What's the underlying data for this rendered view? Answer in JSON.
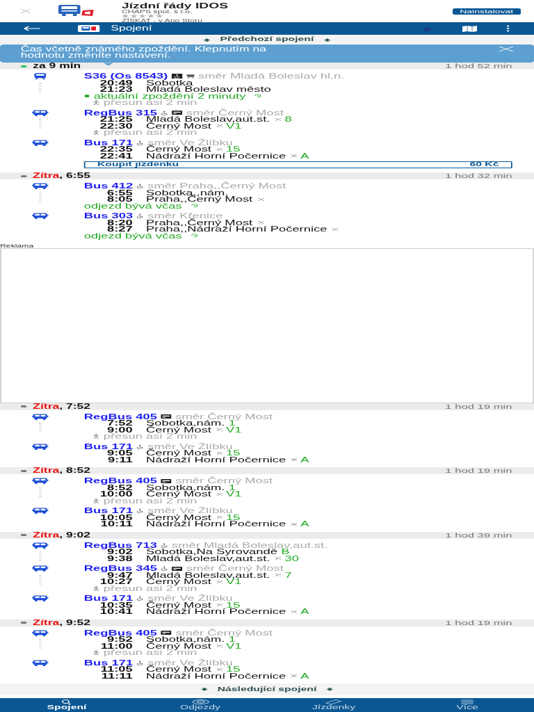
{
  "app_banner": {
    "title": "Jízdní řády IDOS",
    "publisher": "CHAPS spol. s r.o.",
    "stars": 0,
    "store_text": "ZÍSKAT - v App Storu",
    "install_button": "Nainstalovat"
  },
  "nav": {
    "title": "Spojení"
  },
  "previous": "Předchozí spojení",
  "info": "Čas včetně známého zpoždění. Klepnutím na hodnotu změníte nastavení.",
  "connections": [
    {
      "color": "#22c55e",
      "label": "za 9 min",
      "duration": "1 hod 52 min",
      "legs": [
        {
          "kind": "train",
          "line": "S36 (Os 8543)",
          "icons": [
            {
              "kind": "accessible_box"
            },
            {
              "kind": "cart"
            }
          ],
          "direction": "směr Mladá Boleslav hl.n.",
          "stops": [
            {
              "time": "20:49",
              "name": "Sobotka",
              "request": false
            },
            {
              "time": "21:23",
              "name": "Mladá Boleslav město",
              "request": false
            }
          ],
          "notes": [
            {
              "kind": "delay",
              "text": "aktuální zpoždění 2 minuty"
            },
            {
              "kind": "transfer",
              "text": "přesun asi 2 min"
            }
          ]
        },
        {
          "kind": "bus",
          "line": "RegBus 315",
          "icons": [
            {
              "kind": "accessible"
            },
            {
              "kind": "card"
            }
          ],
          "direction": "směr Černý Most",
          "stops": [
            {
              "time": "21:25",
              "name": "Mladá Boleslav,aut.st.",
              "request": true,
              "platform": "8"
            },
            {
              "time": "22:30",
              "name": "Černý Most",
              "request": true,
              "platform": "V1"
            }
          ],
          "notes": [
            {
              "kind": "transfer",
              "text": "přesun asi 2 min"
            }
          ]
        },
        {
          "kind": "bus",
          "line": "Bus 171",
          "icons": [
            {
              "kind": "accessible"
            }
          ],
          "direction": "směr Ve Žlíbku",
          "stops": [
            {
              "time": "22:35",
              "name": "Černý Most",
              "request": true,
              "platform": "15"
            },
            {
              "time": "22:41",
              "name": "Nádraží Horní Počernice",
              "request": true,
              "platform": "A"
            }
          ]
        }
      ],
      "ticket": {
        "label": "Koupit jízdenku",
        "price": "60 Kč"
      }
    },
    {
      "color": "#777777",
      "day": "Zítra",
      "label": ", 6:55",
      "duration": "1 hod 32 min",
      "legs": [
        {
          "kind": "bus",
          "line": "Bus 412",
          "icons": [
            {
              "kind": "accessible"
            }
          ],
          "direction": "směr Praha,,Černý Most",
          "stops": [
            {
              "time": "6:55",
              "name": "Sobotka,,nám.",
              "request": false
            },
            {
              "time": "8:05",
              "name": "Praha,,Černý Most",
              "request": true
            }
          ],
          "notes": [
            {
              "kind": "punctual",
              "text": "odjezd bývá včas"
            }
          ]
        },
        {
          "kind": "bus",
          "line": "Bus 303",
          "icons": [
            {
              "kind": "accessible"
            }
          ],
          "direction": "směr Křenice",
          "stops": [
            {
              "time": "8:20",
              "name": "Praha,,Černý Most",
              "request": true
            },
            {
              "time": "8:27",
              "name": "Praha,,Nádraží Horní Počernice",
              "request": true
            }
          ],
          "notes": [
            {
              "kind": "punctual",
              "text": "odjezd bývá včas"
            }
          ]
        }
      ]
    },
    {
      "kind": "ad",
      "label": "Reklama"
    },
    {
      "color": "#777777",
      "day": "Zítra",
      "label": ", 7:52",
      "duration": "1 hod 19 min",
      "legs": [
        {
          "kind": "bus",
          "line": "RegBus 405",
          "icons": [
            {
              "kind": "card"
            }
          ],
          "direction": "směr Černý Most",
          "stops": [
            {
              "time": "7:52",
              "name": "Sobotka,nám.",
              "request": false,
              "platform": "1"
            },
            {
              "time": "9:00",
              "name": "Černý Most",
              "request": true,
              "platform": "V1"
            }
          ],
          "notes": [
            {
              "kind": "transfer",
              "text": "přesun asi 2 min"
            }
          ]
        },
        {
          "kind": "bus",
          "line": "Bus 171",
          "icons": [
            {
              "kind": "accessible"
            }
          ],
          "direction": "směr Ve Žlíbku",
          "stops": [
            {
              "time": "9:05",
              "name": "Černý Most",
              "request": true,
              "platform": "15"
            },
            {
              "time": "9:11",
              "name": "Nádraží Horní Počernice",
              "request": true,
              "platform": "A"
            }
          ]
        }
      ]
    },
    {
      "color": "#777777",
      "day": "Zítra",
      "label": ", 8:52",
      "duration": "1 hod 19 min",
      "legs": [
        {
          "kind": "bus",
          "line": "RegBus 405",
          "icons": [
            {
              "kind": "card"
            }
          ],
          "direction": "směr Černý Most",
          "stops": [
            {
              "time": "8:52",
              "name": "Sobotka,nám.",
              "request": false,
              "platform": "1"
            },
            {
              "time": "10:00",
              "name": "Černý Most",
              "request": true,
              "platform": "V1"
            }
          ],
          "notes": [
            {
              "kind": "transfer",
              "text": "přesun asi 2 min"
            }
          ]
        },
        {
          "kind": "bus",
          "line": "Bus 171",
          "icons": [
            {
              "kind": "accessible"
            }
          ],
          "direction": "směr Ve Žlíbku",
          "stops": [
            {
              "time": "10:05",
              "name": "Černý Most",
              "request": true,
              "platform": "15"
            },
            {
              "time": "10:11",
              "name": "Nádraží Horní Počernice",
              "request": true,
              "platform": "A"
            }
          ]
        }
      ]
    },
    {
      "color": "#777777",
      "day": "Zítra",
      "label": ", 9:02",
      "duration": "1 hod 39 min",
      "legs": [
        {
          "kind": "bus",
          "line": "RegBus 713",
          "icons": [
            {
              "kind": "accessible"
            }
          ],
          "direction": "směr Mladá Boleslav,aut.st.",
          "stops": [
            {
              "time": "9:02",
              "name": "Sobotka,Na Syrovandě",
              "request": false,
              "platform": "B"
            },
            {
              "time": "9:38",
              "name": "Mladá Boleslav,aut.st.",
              "request": true,
              "platform": "30"
            }
          ]
        },
        {
          "kind": "bus",
          "line": "RegBus 345",
          "icons": [
            {
              "kind": "accessible"
            },
            {
              "kind": "card"
            }
          ],
          "direction": "směr Černý Most",
          "stops": [
            {
              "time": "9:47",
              "name": "Mladá Boleslav,aut.st.",
              "request": true,
              "platform": "7"
            },
            {
              "time": "10:27",
              "name": "Černý Most",
              "request": true,
              "platform": "V1"
            }
          ],
          "notes": [
            {
              "kind": "transfer",
              "text": "přesun asi 2 min"
            }
          ]
        },
        {
          "kind": "bus",
          "line": "Bus 171",
          "icons": [
            {
              "kind": "accessible"
            }
          ],
          "direction": "směr Ve Žlíbku",
          "stops": [
            {
              "time": "10:35",
              "name": "Černý Most",
              "request": true,
              "platform": "15"
            },
            {
              "time": "10:41",
              "name": "Nádraží Horní Počernice",
              "request": true,
              "platform": "A"
            }
          ]
        }
      ]
    },
    {
      "color": "#777777",
      "day": "Zítra",
      "label": ", 9:52",
      "duration": "1 hod 19 min",
      "legs": [
        {
          "kind": "bus",
          "line": "RegBus 405",
          "icons": [
            {
              "kind": "card"
            }
          ],
          "direction": "směr Černý Most",
          "stops": [
            {
              "time": "9:52",
              "name": "Sobotka,nám.",
              "request": false,
              "platform": "1"
            },
            {
              "time": "11:00",
              "name": "Černý Most",
              "request": true,
              "platform": "V1"
            }
          ],
          "notes": [
            {
              "kind": "transfer",
              "text": "přesun asi 2 min"
            }
          ]
        },
        {
          "kind": "bus",
          "line": "Bus 171",
          "icons": [
            {
              "kind": "accessible"
            }
          ],
          "direction": "směr Ve Žlíbku",
          "stops": [
            {
              "time": "11:05",
              "name": "Černý Most",
              "request": true,
              "platform": "15"
            },
            {
              "time": "11:11",
              "name": "Nádraží Horní Počernice",
              "request": true,
              "platform": "A"
            }
          ]
        }
      ]
    }
  ],
  "next": "Následující spojení",
  "tabs": [
    {
      "label": "Spojení",
      "selected": true
    },
    {
      "label": "Odjezdy",
      "selected": false
    },
    {
      "label": "Jízdenky",
      "selected": false
    },
    {
      "label": "Více",
      "selected": false
    }
  ]
}
